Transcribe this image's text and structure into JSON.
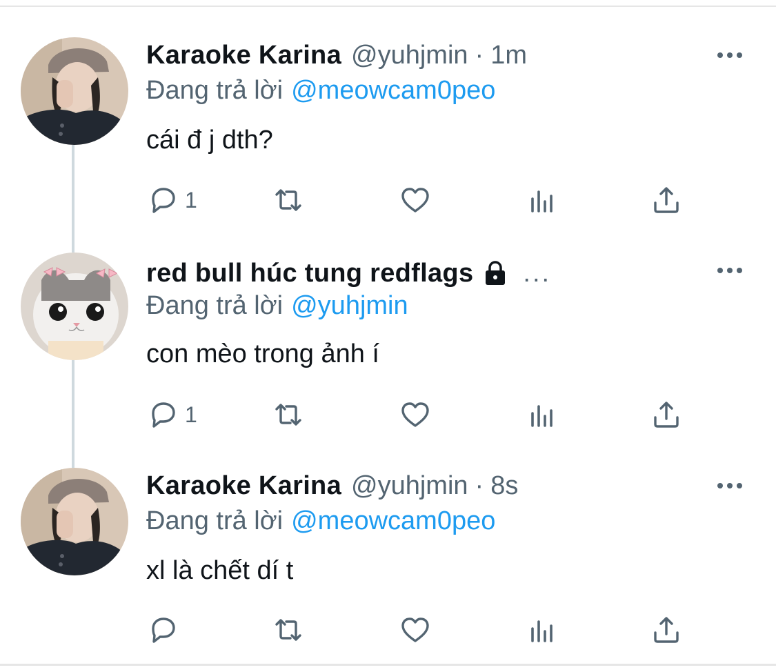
{
  "colors": {
    "link": "#1d9bf0",
    "secondary": "#536471",
    "primary": "#0f1419"
  },
  "tweets": [
    {
      "name": "Karaoke Karina",
      "handle": "@yuhjmin",
      "separator": "·",
      "time": "1m",
      "replying_label": "Đang trả lời",
      "replying_to": "@meowcam0peo",
      "text": "cái đ j dth?",
      "reply_count": "1",
      "avatar": "person-in-cap-avatar"
    },
    {
      "name": "red bull húc tung redflags",
      "locked_icon": "lock-icon",
      "truncation": "...",
      "replying_label": "Đang trả lời",
      "replying_to": "@yuhjmin",
      "text": "con mèo trong ảnh í",
      "reply_count": "1",
      "avatar": "cat-with-bows-avatar"
    },
    {
      "name": "Karaoke Karina",
      "handle": "@yuhjmin",
      "separator": "·",
      "time": "8s",
      "replying_label": "Đang trả lời",
      "replying_to": "@meowcam0peo",
      "text": "xl là chết dí t",
      "reply_count": "",
      "avatar": "person-in-cap-avatar"
    }
  ],
  "action_icons": [
    "reply-icon",
    "retweet-icon",
    "like-icon",
    "views-icon",
    "share-icon"
  ]
}
